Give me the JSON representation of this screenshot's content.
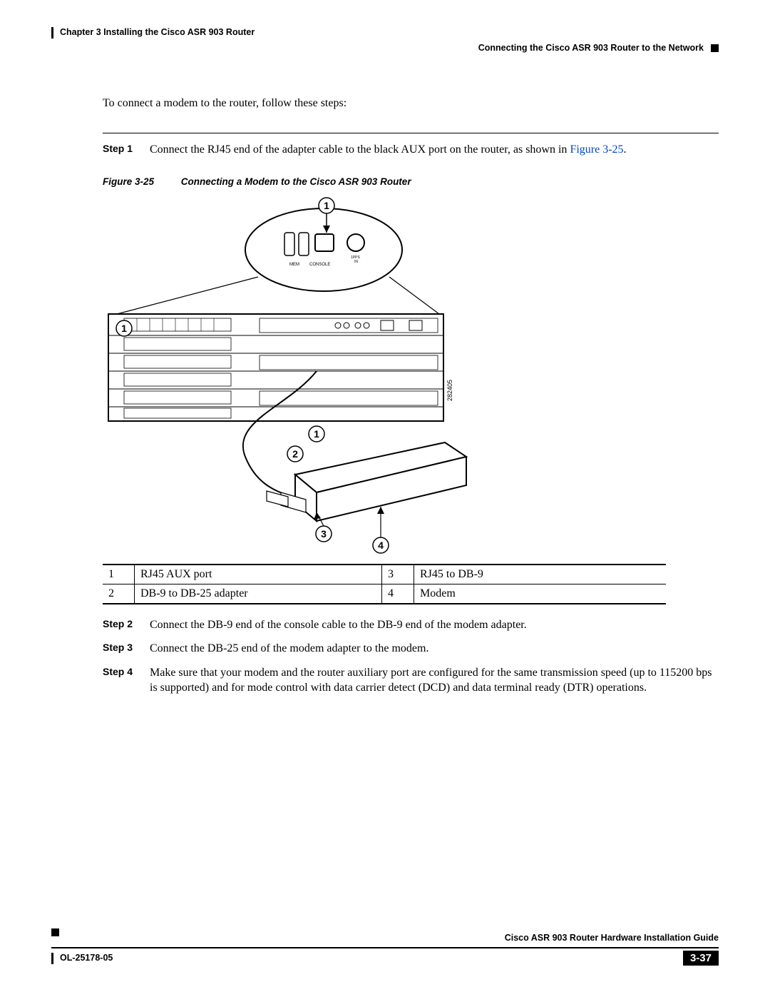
{
  "header": {
    "chapter": "Chapter 3    Installing the Cisco ASR 903 Router",
    "section": "Connecting the Cisco ASR 903 Router to the Network"
  },
  "intro": "To connect a modem to the router, follow these steps:",
  "steps": [
    {
      "label": "Step 1",
      "text_before_link": "Connect the RJ45 end of the adapter cable to the black AUX port on the router, as shown in ",
      "link_text": "Figure 3-25",
      "text_after_link": "."
    },
    {
      "label": "Step 2",
      "text": "Connect the DB-9 end of the console cable to the DB-9 end of the modem adapter."
    },
    {
      "label": "Step 3",
      "text": "Connect the DB-25 end of the modem adapter to the modem."
    },
    {
      "label": "Step 4",
      "text": "Make sure that your modem and the router auxiliary port are configured for the same transmission speed (up to 115200 bps is supported) and for mode control with data carrier detect (DCD) and data terminal ready (DTR) operations."
    }
  ],
  "figure": {
    "label": "Figure 3-25",
    "caption": "Connecting a Modem to the Cisco ASR 903 Router",
    "callouts": [
      "1",
      "1",
      "1",
      "2",
      "3",
      "4"
    ],
    "drawing_number": "282405"
  },
  "legend": [
    {
      "n": "1",
      "desc": "RJ45 AUX port",
      "n2": "3",
      "desc2": "RJ45 to DB-9"
    },
    {
      "n": "2",
      "desc": "DB-9 to DB-25 adapter",
      "n2": "4",
      "desc2": "Modem"
    }
  ],
  "footer": {
    "guide": "Cisco ASR 903 Router Hardware Installation Guide",
    "doc": "OL-25178-05",
    "page": "3-37"
  }
}
